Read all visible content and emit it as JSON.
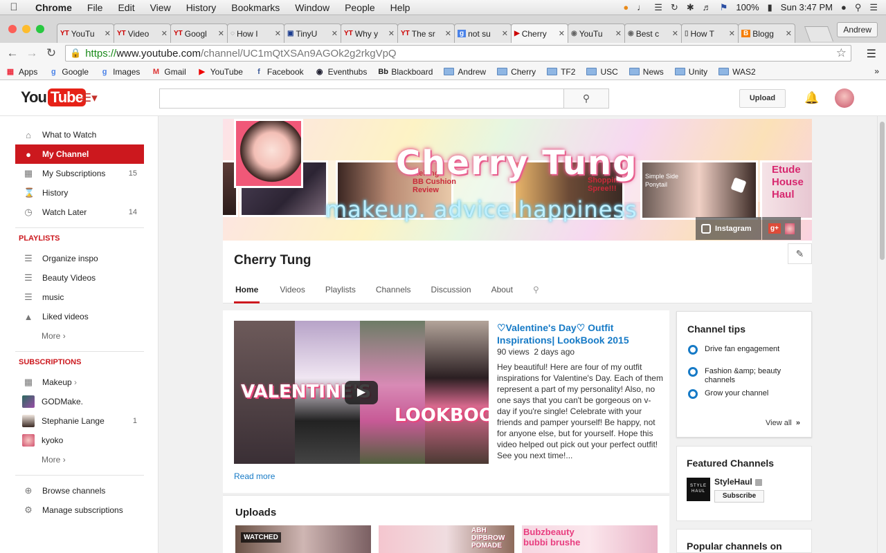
{
  "menubar": {
    "app": "Chrome",
    "items": [
      "File",
      "Edit",
      "View",
      "History",
      "Bookmarks",
      "Window",
      "People",
      "Help"
    ],
    "battery": "100%",
    "clock": "Sun 3:47 PM"
  },
  "tabs": [
    {
      "label": "YouTu",
      "fav": "YT"
    },
    {
      "label": "Video",
      "fav": "YT"
    },
    {
      "label": "Googl",
      "fav": "YT"
    },
    {
      "label": "How I",
      "fav": "◌"
    },
    {
      "label": "TinyU",
      "fav": "▣"
    },
    {
      "label": "Why y",
      "fav": "YT"
    },
    {
      "label": "The sr",
      "fav": "YT"
    },
    {
      "label": "not su",
      "fav": "g"
    },
    {
      "label": "Cherry",
      "fav": "▶"
    },
    {
      "label": "YouTu",
      "fav": "◉"
    },
    {
      "label": "Best c",
      "fav": "◉"
    },
    {
      "label": "How T",
      "fav": "▯"
    },
    {
      "label": "Blogg",
      "fav": "B"
    }
  ],
  "profile": "Andrew",
  "address": {
    "scheme": "https://",
    "host": "www.youtube.com",
    "path": "/channel/UC1mQtXSAn9AGOk2g2rkgVpQ"
  },
  "bookmarks": [
    "Apps",
    "Google",
    "Images",
    "Gmail",
    "YouTube",
    "Facebook",
    "Eventhubs",
    "Blackboard",
    "Andrew",
    "Cherry",
    "TF2",
    "USC",
    "News",
    "Unity",
    "WAS2"
  ],
  "youtube": {
    "logo_you": "You",
    "logo_tube": "Tube",
    "upload": "Upload"
  },
  "sidebar": {
    "main": [
      {
        "label": "What to Watch",
        "count": ""
      },
      {
        "label": "My Channel",
        "count": ""
      },
      {
        "label": "My Subscriptions",
        "count": "15"
      },
      {
        "label": "History",
        "count": ""
      },
      {
        "label": "Watch Later",
        "count": "14"
      }
    ],
    "playlists_heading": "PLAYLISTS",
    "playlists": [
      "Organize inspo",
      "Beauty Videos",
      "music",
      "Liked videos"
    ],
    "more": "More",
    "subs_heading": "SUBSCRIPTIONS",
    "subscriptions": [
      {
        "label": "Makeup",
        "count": ""
      },
      {
        "label": "GODMake.",
        "count": ""
      },
      {
        "label": "Stephanie Lange",
        "count": "1"
      },
      {
        "label": "kyoko",
        "count": ""
      }
    ],
    "browse": "Browse channels",
    "manage": "Manage subscriptions"
  },
  "banner": {
    "name": "Cherry Tung",
    "tagline": "makeup. advice.happiness",
    "overlay1": "Melting\nBB Cushion\nReview",
    "overlay2": "Shoppin\nSpree!!!",
    "overlay3": "Etude\nHouse\nHaul",
    "overlay4": "Simple Side\nPonytail",
    "instagram": "Instagram",
    "gplus": "g+"
  },
  "channel": {
    "name": "Cherry Tung",
    "tabs": [
      "Home",
      "Videos",
      "Playlists",
      "Channels",
      "Discussion",
      "About"
    ]
  },
  "featured_video": {
    "title": "♡Valentine's Day♡ Outfit Inspirations| LookBook 2015",
    "views": "90 views",
    "age": "2 days ago",
    "description": "Hey beautiful! Here are four of my outfit inspirations for Valentine's Day. Each of them represent a part of my personality! Also, no one says that you can't be gorgeous on v-day if you're single! Celebrate with your friends and pamper yourself! Be happy, not for anyone else, but for yourself. Hope this video helped out pick out your perfect outfit! See you next time!...",
    "thumb_text1": "VALENTINE'S",
    "thumb_text2": "LOOKBOOK",
    "read_more": "Read more"
  },
  "uploads": {
    "title": "Uploads",
    "watched": "WATCHED",
    "thumb2_text": "ABH\nDIPBROW\nPOMADE",
    "thumb3_text": "Bubzbeauty\nbubbi brushe"
  },
  "channel_tips": {
    "title": "Channel tips",
    "items": [
      "Drive fan engagement",
      "Fashion &amp; beauty channels",
      "Grow your channel"
    ],
    "view_all": "View all"
  },
  "featured_channels": {
    "title": "Featured Channels",
    "channel": "StyleHaul",
    "logo": "STYLE HAUL",
    "subscribe": "Subscribe"
  },
  "popular": {
    "title": "Popular channels on"
  }
}
